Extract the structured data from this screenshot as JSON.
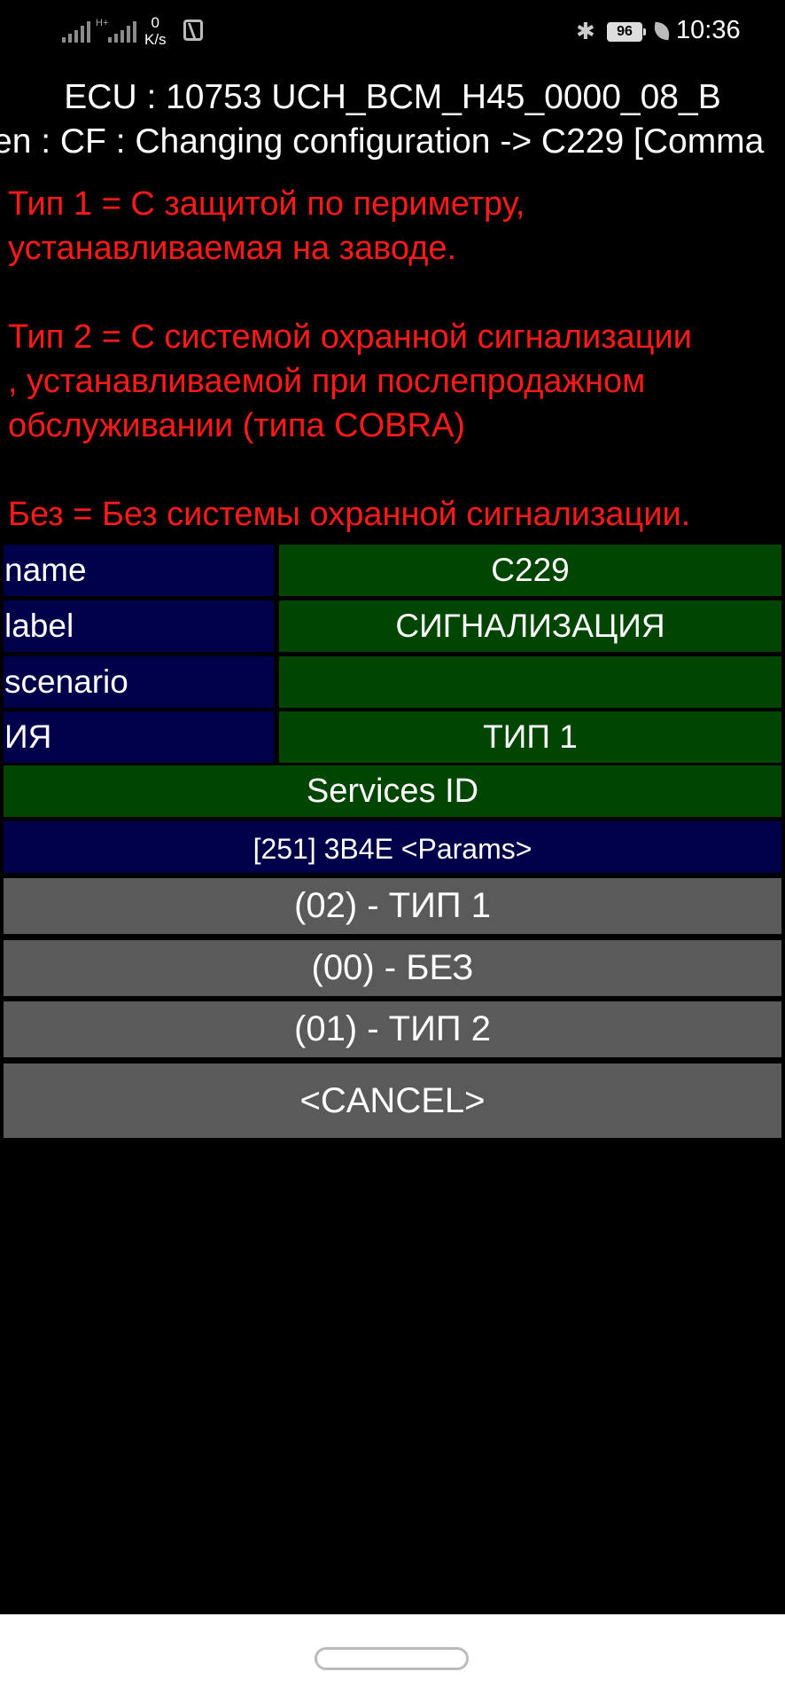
{
  "status_bar": {
    "network_speed_value": "0",
    "network_speed_unit": "K/s",
    "battery": "96",
    "time": "10:36",
    "icons": [
      "signal-icon",
      "signal-h-plus-icon",
      "nfc-icon",
      "bluetooth-icon",
      "battery-icon",
      "power-saving-leaf-icon"
    ]
  },
  "header": {
    "ecu_line": "ECU : 10753  UCH_BCM_H45_0000_08_B",
    "screen_line": "en : CF : Changing configuration -> C229 [Comma"
  },
  "description": "Тип 1 = С защитой по периметру,\nустанавливаемая на заводе.\n\nТип 2 = С системой охранной сигнализации\n, устанавливаемой при послепродажном\nобслуживании (типа COBRA)\n\nБез = Без системы охранной сигнализации.",
  "table": {
    "rows": [
      {
        "key": "name",
        "value": "C229"
      },
      {
        "key": "label",
        "value": "СИГНАЛИЗАЦИЯ"
      },
      {
        "key": "scenario",
        "value": ""
      },
      {
        "key": "ИЯ",
        "value": "ТИП 1"
      }
    ],
    "services_label": "Services ID",
    "params_label": "[251] 3B4E <Params>"
  },
  "options": [
    "(02) - ТИП 1",
    "(00) - БЕЗ",
    "(01) - ТИП 2"
  ],
  "cancel_label": "<CANCEL>",
  "colors": {
    "description_text": "#ff1a1a",
    "key_cell": "#00004a",
    "value_cell": "#004500",
    "option_button": "#5a5a5a",
    "background": "#000000"
  }
}
